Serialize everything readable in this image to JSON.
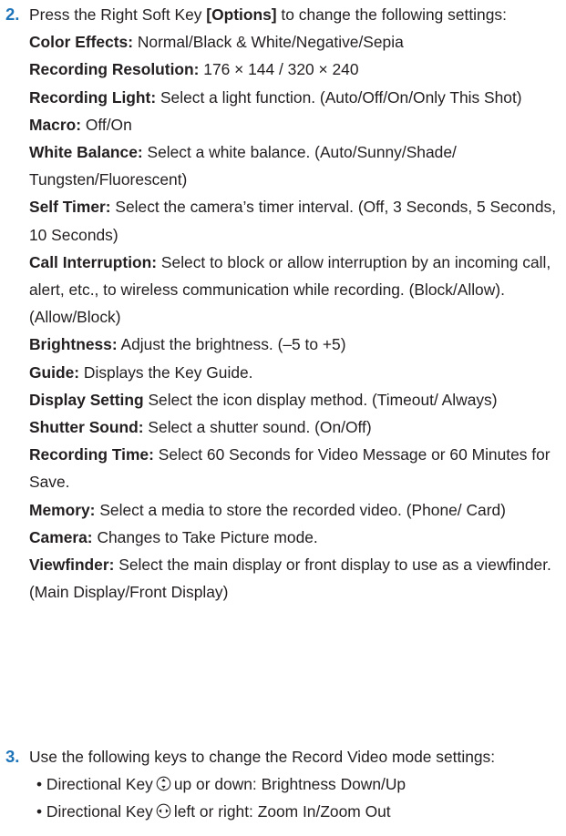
{
  "step2": {
    "number": "2.",
    "intro_before": "Press the Right Soft Key ",
    "intro_key": "[Options]",
    "intro_after": " to change the following settings:",
    "items": [
      {
        "label": "Color Effects:",
        "text": " Normal/Black & White/Negative/Sepia"
      },
      {
        "label": "Recording Resolution:",
        "text": " 176 × 144 / 320 × 240"
      },
      {
        "label": "Recording Light:",
        "text": " Select a light function. (Auto/Off/On/Only This Shot)"
      },
      {
        "label": "Macro:",
        "text": " Off/On"
      },
      {
        "label": "White Balance:",
        "text": " Select a white balance. (Auto/Sunny/Shade/ Tungsten/Fluorescent)"
      },
      {
        "label": "Self Timer:",
        "text": " Select the camera’s timer interval. (Off, 3 Seconds, 5 Seconds, 10 Seconds)"
      },
      {
        "label": "Call Interruption:",
        "text": " Select to block or allow interruption by an incoming call, alert, etc., to wireless communication while recording. (Block/Allow). (Allow/Block)"
      },
      {
        "label": "Brightness:",
        "text": " Adjust the brightness. (–5 to +5)"
      },
      {
        "label": "Guide:",
        "text": " Displays the Key Guide."
      },
      {
        "label": "Display Setting",
        "text": " Select the icon display method. (Timeout/ Always)"
      },
      {
        "label": "Shutter Sound:",
        "text": " Select a shutter sound. (On/Off)"
      },
      {
        "label": "Recording Time:",
        "text": " Select 60 Seconds for Video Message or 60 Minutes for Save."
      },
      {
        "label": "Memory:",
        "text": " Select a media to store the recorded video. (Phone/ Card)"
      },
      {
        "label": "Camera:",
        "text": " Changes to Take Picture mode."
      },
      {
        "label": "Viewfinder:",
        "text": " Select the main display or front display to use as a viewfinder. (Main Display/Front Display)"
      }
    ]
  },
  "step3": {
    "number": "3.",
    "intro": "Use the following keys to change the Record Video mode settings:",
    "bullets": [
      {
        "prefix": "• Directional Key",
        "icon": "directional-up-down-icon",
        "text": "up or down: Brightness Down/Up"
      },
      {
        "prefix": "• Directional Key",
        "icon": "directional-left-right-icon",
        "text": "left or right: Zoom In/Zoom Out"
      }
    ]
  }
}
